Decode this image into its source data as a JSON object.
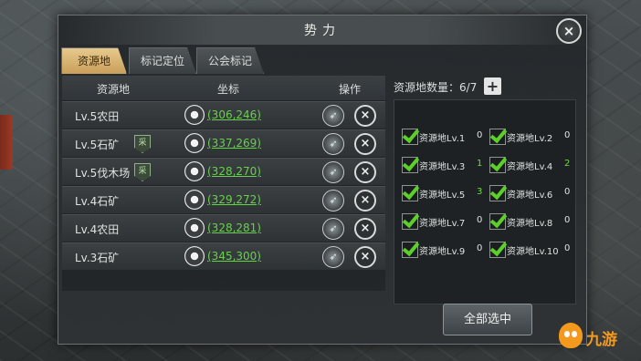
{
  "dialog": {
    "title": "势力",
    "close_label": "×"
  },
  "tabs": [
    {
      "label": "资源地",
      "active": true
    },
    {
      "label": "标记定位",
      "active": false
    },
    {
      "label": "公会标记",
      "active": false
    }
  ],
  "table": {
    "headers": {
      "name": "资源地",
      "coord": "坐标",
      "op": "操作"
    },
    "rows": [
      {
        "name": "Lv.5农田",
        "badge": "",
        "coord": "(306,246)"
      },
      {
        "name": "Lv.5石矿",
        "badge": "采",
        "coord": "(337,269)"
      },
      {
        "name": "Lv.5伐木场",
        "badge": "采",
        "coord": "(328,270)"
      },
      {
        "name": "Lv.4石矿",
        "badge": "",
        "coord": "(329,272)"
      },
      {
        "name": "Lv.4农田",
        "badge": "",
        "coord": "(328,281)"
      },
      {
        "name": "Lv.3石矿",
        "badge": "",
        "coord": "(345,300)"
      }
    ]
  },
  "summary": {
    "label": "资源地数量：",
    "value": "6/7",
    "plus": "+"
  },
  "levels": [
    {
      "label": "资源地Lv.1",
      "count": "0",
      "highlight": false
    },
    {
      "label": "资源地Lv.2",
      "count": "0",
      "highlight": false
    },
    {
      "label": "资源地Lv.3",
      "count": "1",
      "highlight": true
    },
    {
      "label": "资源地Lv.4",
      "count": "2",
      "highlight": true
    },
    {
      "label": "资源地Lv.5",
      "count": "3",
      "highlight": true
    },
    {
      "label": "资源地Lv.6",
      "count": "0",
      "highlight": false
    },
    {
      "label": "资源地Lv.7",
      "count": "0",
      "highlight": false
    },
    {
      "label": "资源地Lv.8",
      "count": "0",
      "highlight": false
    },
    {
      "label": "资源地Lv.9",
      "count": "0",
      "highlight": false
    },
    {
      "label": "资源地Lv.10",
      "count": "0",
      "highlight": false
    }
  ],
  "select_all": "全部选中",
  "watermark": "九游",
  "colors": {
    "coord_link": "#67d14c",
    "check": "#5ccf2a",
    "tab_active": "#d8b674",
    "watermark": "#f39a1e"
  }
}
